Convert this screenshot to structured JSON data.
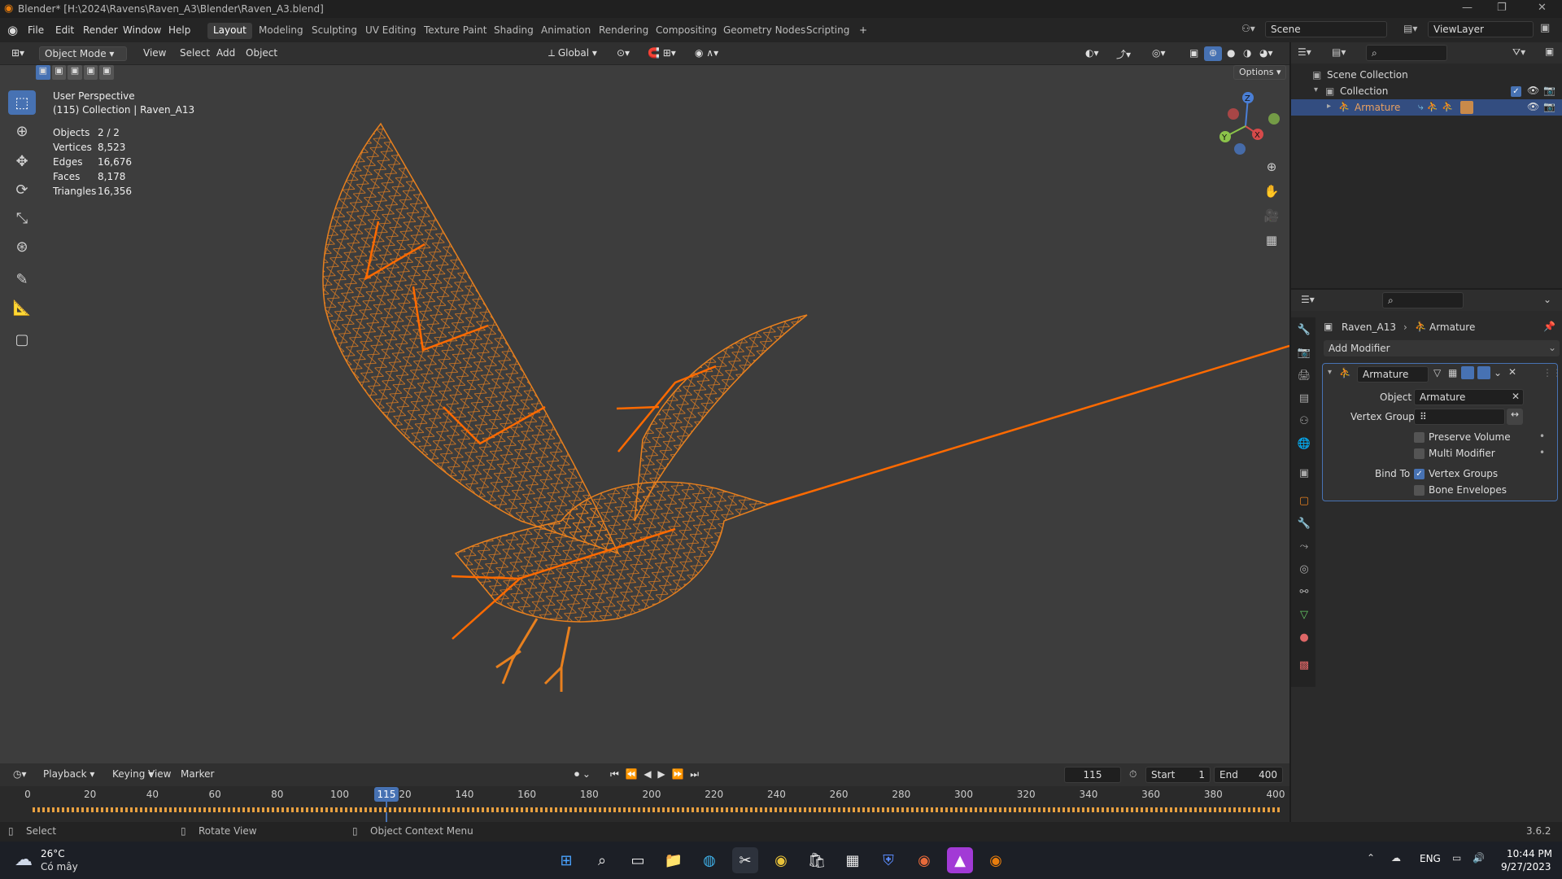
{
  "title_bar": {
    "title": "Blender* [H:\\2024\\Ravens\\Raven_A3\\Blender\\Raven_A3.blend]",
    "minimize": "—",
    "maximize": "❐",
    "close": "✕"
  },
  "menu": {
    "items": [
      "File",
      "Edit",
      "Render",
      "Window",
      "Help"
    ]
  },
  "workspaces": {
    "tabs": [
      "Layout",
      "Modeling",
      "Sculpting",
      "UV Editing",
      "Texture Paint",
      "Shading",
      "Animation",
      "Rendering",
      "Compositing",
      "Geometry Nodes",
      "Scripting"
    ],
    "active": "Layout",
    "add": "+"
  },
  "scene": {
    "name": "Scene",
    "view_layer": "ViewLayer"
  },
  "viewport_header": {
    "mode": "Object Mode",
    "view": "View",
    "select": "Select",
    "add": "Add",
    "object": "Object",
    "transform": "Global",
    "options": "Options"
  },
  "overlay": {
    "perspective": "User Perspective",
    "collection": "(115) Collection | Raven_A13",
    "stats": [
      {
        "label": "Objects",
        "value": "2 / 2"
      },
      {
        "label": "Vertices",
        "value": "8,523"
      },
      {
        "label": "Edges",
        "value": "16,676"
      },
      {
        "label": "Faces",
        "value": "8,178"
      },
      {
        "label": "Triangles",
        "value": "16,356"
      }
    ]
  },
  "gizmo": {
    "x": "X",
    "y": "Y",
    "z": "Z"
  },
  "outliner": {
    "scene_collection": "Scene Collection",
    "collection": "Collection",
    "armature": "Armature"
  },
  "properties": {
    "breadcrumb_obj": "Raven_A13",
    "breadcrumb_mod": "Armature",
    "add_modifier": "Add Modifier",
    "modifier_name": "Armature",
    "object_label": "Object",
    "object_value": "Armature",
    "vertex_group_label": "Vertex Group",
    "preserve_volume": "Preserve Volume",
    "multi_modifier": "Multi Modifier",
    "bind_to": "Bind To",
    "vertex_groups": "Vertex Groups",
    "bone_envelopes": "Bone Envelopes"
  },
  "timeline": {
    "playback": "Playback",
    "keying": "Keying",
    "view": "View",
    "marker": "Marker",
    "current_frame": "115",
    "start_label": "Start",
    "start": "1",
    "end_label": "End",
    "end": "400",
    "ticks": [
      "0",
      "20",
      "40",
      "60",
      "80",
      "100",
      "120",
      "140",
      "160",
      "180",
      "200",
      "220",
      "240",
      "260",
      "280",
      "300",
      "320",
      "340",
      "360",
      "380",
      "400"
    ],
    "frame_badge": "115"
  },
  "status_bar": {
    "select": "Select",
    "rotate": "Rotate View",
    "context": "Object Context Menu",
    "version": "3.6.2"
  },
  "taskbar": {
    "temperature": "26°C",
    "weather": "Có mây",
    "lang": "ENG",
    "time": "10:44 PM",
    "date": "9/27/2023"
  },
  "colors": {
    "accent": "#4772b3",
    "wire": "#e8801e",
    "viewport": "#3d3d3d"
  }
}
